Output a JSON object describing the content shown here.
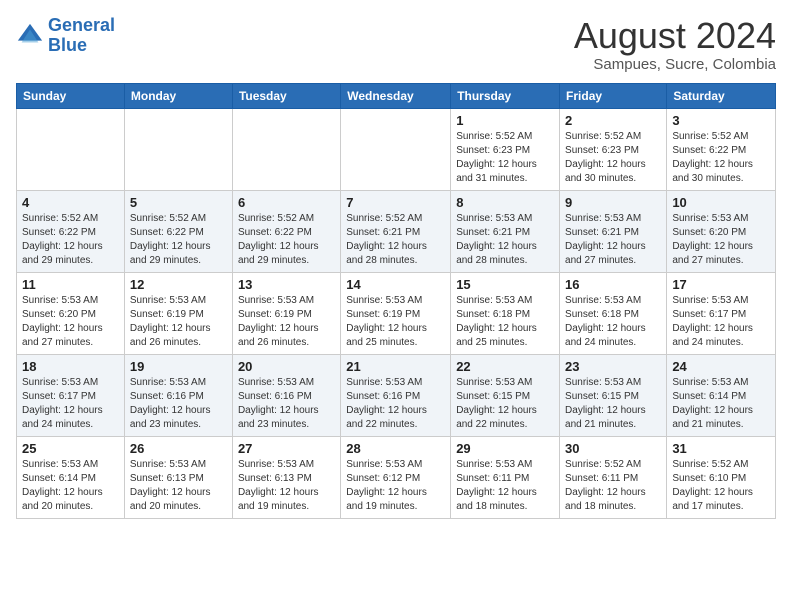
{
  "header": {
    "logo_line1": "General",
    "logo_line2": "Blue",
    "main_title": "August 2024",
    "subtitle": "Sampues, Sucre, Colombia"
  },
  "weekdays": [
    "Sunday",
    "Monday",
    "Tuesday",
    "Wednesday",
    "Thursday",
    "Friday",
    "Saturday"
  ],
  "weeks": [
    [
      {
        "day": "",
        "info": ""
      },
      {
        "day": "",
        "info": ""
      },
      {
        "day": "",
        "info": ""
      },
      {
        "day": "",
        "info": ""
      },
      {
        "day": "1",
        "info": "Sunrise: 5:52 AM\nSunset: 6:23 PM\nDaylight: 12 hours and 31 minutes."
      },
      {
        "day": "2",
        "info": "Sunrise: 5:52 AM\nSunset: 6:23 PM\nDaylight: 12 hours and 30 minutes."
      },
      {
        "day": "3",
        "info": "Sunrise: 5:52 AM\nSunset: 6:22 PM\nDaylight: 12 hours and 30 minutes."
      }
    ],
    [
      {
        "day": "4",
        "info": "Sunrise: 5:52 AM\nSunset: 6:22 PM\nDaylight: 12 hours and 29 minutes."
      },
      {
        "day": "5",
        "info": "Sunrise: 5:52 AM\nSunset: 6:22 PM\nDaylight: 12 hours and 29 minutes."
      },
      {
        "day": "6",
        "info": "Sunrise: 5:52 AM\nSunset: 6:22 PM\nDaylight: 12 hours and 29 minutes."
      },
      {
        "day": "7",
        "info": "Sunrise: 5:52 AM\nSunset: 6:21 PM\nDaylight: 12 hours and 28 minutes."
      },
      {
        "day": "8",
        "info": "Sunrise: 5:53 AM\nSunset: 6:21 PM\nDaylight: 12 hours and 28 minutes."
      },
      {
        "day": "9",
        "info": "Sunrise: 5:53 AM\nSunset: 6:21 PM\nDaylight: 12 hours and 27 minutes."
      },
      {
        "day": "10",
        "info": "Sunrise: 5:53 AM\nSunset: 6:20 PM\nDaylight: 12 hours and 27 minutes."
      }
    ],
    [
      {
        "day": "11",
        "info": "Sunrise: 5:53 AM\nSunset: 6:20 PM\nDaylight: 12 hours and 27 minutes."
      },
      {
        "day": "12",
        "info": "Sunrise: 5:53 AM\nSunset: 6:19 PM\nDaylight: 12 hours and 26 minutes."
      },
      {
        "day": "13",
        "info": "Sunrise: 5:53 AM\nSunset: 6:19 PM\nDaylight: 12 hours and 26 minutes."
      },
      {
        "day": "14",
        "info": "Sunrise: 5:53 AM\nSunset: 6:19 PM\nDaylight: 12 hours and 25 minutes."
      },
      {
        "day": "15",
        "info": "Sunrise: 5:53 AM\nSunset: 6:18 PM\nDaylight: 12 hours and 25 minutes."
      },
      {
        "day": "16",
        "info": "Sunrise: 5:53 AM\nSunset: 6:18 PM\nDaylight: 12 hours and 24 minutes."
      },
      {
        "day": "17",
        "info": "Sunrise: 5:53 AM\nSunset: 6:17 PM\nDaylight: 12 hours and 24 minutes."
      }
    ],
    [
      {
        "day": "18",
        "info": "Sunrise: 5:53 AM\nSunset: 6:17 PM\nDaylight: 12 hours and 24 minutes."
      },
      {
        "day": "19",
        "info": "Sunrise: 5:53 AM\nSunset: 6:16 PM\nDaylight: 12 hours and 23 minutes."
      },
      {
        "day": "20",
        "info": "Sunrise: 5:53 AM\nSunset: 6:16 PM\nDaylight: 12 hours and 23 minutes."
      },
      {
        "day": "21",
        "info": "Sunrise: 5:53 AM\nSunset: 6:16 PM\nDaylight: 12 hours and 22 minutes."
      },
      {
        "day": "22",
        "info": "Sunrise: 5:53 AM\nSunset: 6:15 PM\nDaylight: 12 hours and 22 minutes."
      },
      {
        "day": "23",
        "info": "Sunrise: 5:53 AM\nSunset: 6:15 PM\nDaylight: 12 hours and 21 minutes."
      },
      {
        "day": "24",
        "info": "Sunrise: 5:53 AM\nSunset: 6:14 PM\nDaylight: 12 hours and 21 minutes."
      }
    ],
    [
      {
        "day": "25",
        "info": "Sunrise: 5:53 AM\nSunset: 6:14 PM\nDaylight: 12 hours and 20 minutes."
      },
      {
        "day": "26",
        "info": "Sunrise: 5:53 AM\nSunset: 6:13 PM\nDaylight: 12 hours and 20 minutes."
      },
      {
        "day": "27",
        "info": "Sunrise: 5:53 AM\nSunset: 6:13 PM\nDaylight: 12 hours and 19 minutes."
      },
      {
        "day": "28",
        "info": "Sunrise: 5:53 AM\nSunset: 6:12 PM\nDaylight: 12 hours and 19 minutes."
      },
      {
        "day": "29",
        "info": "Sunrise: 5:53 AM\nSunset: 6:11 PM\nDaylight: 12 hours and 18 minutes."
      },
      {
        "day": "30",
        "info": "Sunrise: 5:52 AM\nSunset: 6:11 PM\nDaylight: 12 hours and 18 minutes."
      },
      {
        "day": "31",
        "info": "Sunrise: 5:52 AM\nSunset: 6:10 PM\nDaylight: 12 hours and 17 minutes."
      }
    ]
  ]
}
